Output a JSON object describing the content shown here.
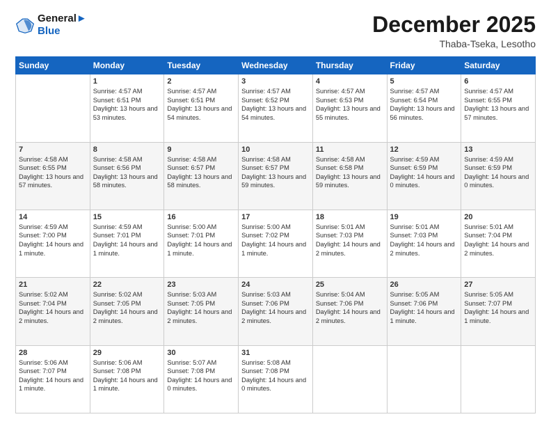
{
  "logo": {
    "line1": "General",
    "line2": "Blue"
  },
  "title": "December 2025",
  "location": "Thaba-Tseka, Lesotho",
  "headers": [
    "Sunday",
    "Monday",
    "Tuesday",
    "Wednesday",
    "Thursday",
    "Friday",
    "Saturday"
  ],
  "weeks": [
    [
      {
        "day": "",
        "sunrise": "",
        "sunset": "",
        "daylight": ""
      },
      {
        "day": "1",
        "sunrise": "Sunrise: 4:57 AM",
        "sunset": "Sunset: 6:51 PM",
        "daylight": "Daylight: 13 hours and 53 minutes."
      },
      {
        "day": "2",
        "sunrise": "Sunrise: 4:57 AM",
        "sunset": "Sunset: 6:51 PM",
        "daylight": "Daylight: 13 hours and 54 minutes."
      },
      {
        "day": "3",
        "sunrise": "Sunrise: 4:57 AM",
        "sunset": "Sunset: 6:52 PM",
        "daylight": "Daylight: 13 hours and 54 minutes."
      },
      {
        "day": "4",
        "sunrise": "Sunrise: 4:57 AM",
        "sunset": "Sunset: 6:53 PM",
        "daylight": "Daylight: 13 hours and 55 minutes."
      },
      {
        "day": "5",
        "sunrise": "Sunrise: 4:57 AM",
        "sunset": "Sunset: 6:54 PM",
        "daylight": "Daylight: 13 hours and 56 minutes."
      },
      {
        "day": "6",
        "sunrise": "Sunrise: 4:57 AM",
        "sunset": "Sunset: 6:55 PM",
        "daylight": "Daylight: 13 hours and 57 minutes."
      }
    ],
    [
      {
        "day": "7",
        "sunrise": "Sunrise: 4:58 AM",
        "sunset": "Sunset: 6:55 PM",
        "daylight": "Daylight: 13 hours and 57 minutes."
      },
      {
        "day": "8",
        "sunrise": "Sunrise: 4:58 AM",
        "sunset": "Sunset: 6:56 PM",
        "daylight": "Daylight: 13 hours and 58 minutes."
      },
      {
        "day": "9",
        "sunrise": "Sunrise: 4:58 AM",
        "sunset": "Sunset: 6:57 PM",
        "daylight": "Daylight: 13 hours and 58 minutes."
      },
      {
        "day": "10",
        "sunrise": "Sunrise: 4:58 AM",
        "sunset": "Sunset: 6:57 PM",
        "daylight": "Daylight: 13 hours and 59 minutes."
      },
      {
        "day": "11",
        "sunrise": "Sunrise: 4:58 AM",
        "sunset": "Sunset: 6:58 PM",
        "daylight": "Daylight: 13 hours and 59 minutes."
      },
      {
        "day": "12",
        "sunrise": "Sunrise: 4:59 AM",
        "sunset": "Sunset: 6:59 PM",
        "daylight": "Daylight: 14 hours and 0 minutes."
      },
      {
        "day": "13",
        "sunrise": "Sunrise: 4:59 AM",
        "sunset": "Sunset: 6:59 PM",
        "daylight": "Daylight: 14 hours and 0 minutes."
      }
    ],
    [
      {
        "day": "14",
        "sunrise": "Sunrise: 4:59 AM",
        "sunset": "Sunset: 7:00 PM",
        "daylight": "Daylight: 14 hours and 1 minute."
      },
      {
        "day": "15",
        "sunrise": "Sunrise: 4:59 AM",
        "sunset": "Sunset: 7:01 PM",
        "daylight": "Daylight: 14 hours and 1 minute."
      },
      {
        "day": "16",
        "sunrise": "Sunrise: 5:00 AM",
        "sunset": "Sunset: 7:01 PM",
        "daylight": "Daylight: 14 hours and 1 minute."
      },
      {
        "day": "17",
        "sunrise": "Sunrise: 5:00 AM",
        "sunset": "Sunset: 7:02 PM",
        "daylight": "Daylight: 14 hours and 1 minute."
      },
      {
        "day": "18",
        "sunrise": "Sunrise: 5:01 AM",
        "sunset": "Sunset: 7:03 PM",
        "daylight": "Daylight: 14 hours and 2 minutes."
      },
      {
        "day": "19",
        "sunrise": "Sunrise: 5:01 AM",
        "sunset": "Sunset: 7:03 PM",
        "daylight": "Daylight: 14 hours and 2 minutes."
      },
      {
        "day": "20",
        "sunrise": "Sunrise: 5:01 AM",
        "sunset": "Sunset: 7:04 PM",
        "daylight": "Daylight: 14 hours and 2 minutes."
      }
    ],
    [
      {
        "day": "21",
        "sunrise": "Sunrise: 5:02 AM",
        "sunset": "Sunset: 7:04 PM",
        "daylight": "Daylight: 14 hours and 2 minutes."
      },
      {
        "day": "22",
        "sunrise": "Sunrise: 5:02 AM",
        "sunset": "Sunset: 7:05 PM",
        "daylight": "Daylight: 14 hours and 2 minutes."
      },
      {
        "day": "23",
        "sunrise": "Sunrise: 5:03 AM",
        "sunset": "Sunset: 7:05 PM",
        "daylight": "Daylight: 14 hours and 2 minutes."
      },
      {
        "day": "24",
        "sunrise": "Sunrise: 5:03 AM",
        "sunset": "Sunset: 7:06 PM",
        "daylight": "Daylight: 14 hours and 2 minutes."
      },
      {
        "day": "25",
        "sunrise": "Sunrise: 5:04 AM",
        "sunset": "Sunset: 7:06 PM",
        "daylight": "Daylight: 14 hours and 2 minutes."
      },
      {
        "day": "26",
        "sunrise": "Sunrise: 5:05 AM",
        "sunset": "Sunset: 7:06 PM",
        "daylight": "Daylight: 14 hours and 1 minute."
      },
      {
        "day": "27",
        "sunrise": "Sunrise: 5:05 AM",
        "sunset": "Sunset: 7:07 PM",
        "daylight": "Daylight: 14 hours and 1 minute."
      }
    ],
    [
      {
        "day": "28",
        "sunrise": "Sunrise: 5:06 AM",
        "sunset": "Sunset: 7:07 PM",
        "daylight": "Daylight: 14 hours and 1 minute."
      },
      {
        "day": "29",
        "sunrise": "Sunrise: 5:06 AM",
        "sunset": "Sunset: 7:08 PM",
        "daylight": "Daylight: 14 hours and 1 minute."
      },
      {
        "day": "30",
        "sunrise": "Sunrise: 5:07 AM",
        "sunset": "Sunset: 7:08 PM",
        "daylight": "Daylight: 14 hours and 0 minutes."
      },
      {
        "day": "31",
        "sunrise": "Sunrise: 5:08 AM",
        "sunset": "Sunset: 7:08 PM",
        "daylight": "Daylight: 14 hours and 0 minutes."
      },
      {
        "day": "",
        "sunrise": "",
        "sunset": "",
        "daylight": ""
      },
      {
        "day": "",
        "sunrise": "",
        "sunset": "",
        "daylight": ""
      },
      {
        "day": "",
        "sunrise": "",
        "sunset": "",
        "daylight": ""
      }
    ]
  ]
}
